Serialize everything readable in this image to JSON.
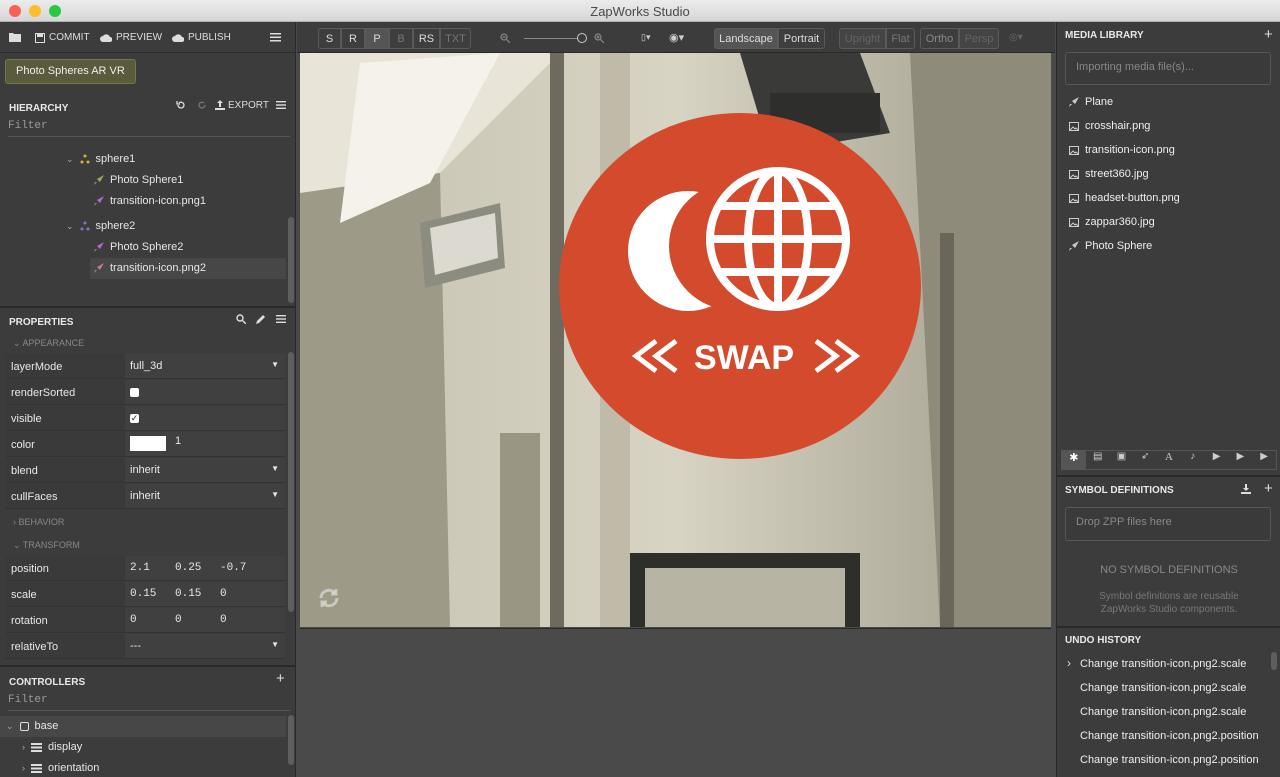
{
  "window": {
    "title": "ZapWorks Studio"
  },
  "toolbar": {
    "commit": "COMMIT",
    "preview": "PREVIEW",
    "publish": "PUBLISH"
  },
  "project": {
    "name": "Photo Spheres AR VR"
  },
  "hierarchy": {
    "title": "HIERARCHY",
    "export": "EXPORT",
    "filter_placeholder": "Filter",
    "rows": [
      {
        "label": "sphere1"
      },
      {
        "label": "Photo Sphere1"
      },
      {
        "label": "transition-icon.png1"
      },
      {
        "label": "sphere2"
      },
      {
        "label": "Photo Sphere2"
      },
      {
        "label": "transition-icon.png2"
      }
    ]
  },
  "properties": {
    "title": "PROPERTIES",
    "appearance": "APPEARANCE",
    "behavior": "BEHAVIOR",
    "transform": "TRANSFORM",
    "layerMode": {
      "label": "layerMode",
      "value": "full_3d"
    },
    "renderSorted": {
      "label": "renderSorted",
      "checked": false
    },
    "visible": {
      "label": "visible",
      "checked": true
    },
    "color": {
      "label": "color",
      "value": "1",
      "swatch": "#ffffff"
    },
    "blend": {
      "label": "blend",
      "value": "inherit"
    },
    "cullFaces": {
      "label": "cullFaces",
      "value": "inherit"
    },
    "position": {
      "label": "position",
      "x": "2.1",
      "y": "0.25",
      "z": "-0.7"
    },
    "scale": {
      "label": "scale",
      "x": "0.15",
      "y": "0.15",
      "z": "0"
    },
    "rotation": {
      "label": "rotation",
      "x": "0",
      "y": "0",
      "z": "0"
    },
    "relativeTo": {
      "label": "relativeTo",
      "value": "---"
    }
  },
  "controllers": {
    "title": "CONTROLLERS",
    "filter_placeholder": "Filter",
    "items": [
      {
        "label": "base"
      },
      {
        "label": "display"
      },
      {
        "label": "orientation"
      }
    ]
  },
  "viewbar": {
    "modes": [
      "S",
      "R",
      "P",
      "B",
      "RS",
      "TXT"
    ],
    "active_mode": "P",
    "landscape": "Landscape",
    "portrait": "Portrait",
    "upright": "Upright",
    "flat": "Flat",
    "ortho": "Ortho",
    "persp": "Persp",
    "zoom_fraction": 1.0
  },
  "viewport": {
    "swap_text": "SWAP",
    "accent": "#d44a2c"
  },
  "media": {
    "title": "MEDIA LIBRARY",
    "import_placeholder": "Importing media file(s)...",
    "items": [
      {
        "label": "Plane",
        "icon": "rocket-icon"
      },
      {
        "label": "crosshair.png",
        "icon": "image-icon"
      },
      {
        "label": "transition-icon.png",
        "icon": "image-icon"
      },
      {
        "label": "street360.jpg",
        "icon": "image-icon"
      },
      {
        "label": "headset-button.png",
        "icon": "image-icon"
      },
      {
        "label": "zappar360.jpg",
        "icon": "image-icon"
      },
      {
        "label": "Photo Sphere",
        "icon": "rocket-icon"
      }
    ]
  },
  "symbols": {
    "title": "SYMBOL DEFINITIONS",
    "drop_placeholder": "Drop ZPP files here",
    "empty_title": "NO SYMBOL DEFINITIONS",
    "empty_desc_1": "Symbol definitions are reusable",
    "empty_desc_2": "ZapWorks Studio components."
  },
  "history": {
    "title": "UNDO HISTORY",
    "items": [
      "Change transition-icon.png2.scale",
      "Change transition-icon.png2.scale",
      "Change transition-icon.png2.scale",
      "Change transition-icon.png2.position",
      "Change transition-icon.png2.position"
    ]
  }
}
